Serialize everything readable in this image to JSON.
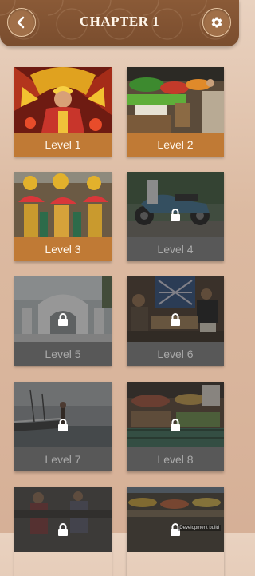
{
  "header": {
    "title": "CHAPTER 1",
    "back_icon": "chevron-left-icon",
    "settings_icon": "gear-icon"
  },
  "levels": [
    {
      "label": "Level 1",
      "locked": false,
      "scene": "festival-dancer"
    },
    {
      "label": "Level 2",
      "locked": false,
      "scene": "vegetable-market"
    },
    {
      "label": "Level 3",
      "locked": false,
      "scene": "festival-fan-dancers"
    },
    {
      "label": "Level 4",
      "locked": true,
      "scene": "motorbike"
    },
    {
      "label": "Level 5",
      "locked": true,
      "scene": "white-church"
    },
    {
      "label": "Level 6",
      "locked": true,
      "scene": "weaving-workshop"
    },
    {
      "label": "Level 7",
      "locked": true,
      "scene": "boat-on-water"
    },
    {
      "label": "Level 8",
      "locked": true,
      "scene": "market-crates"
    },
    {
      "label": "",
      "locked": true,
      "scene": "people-street"
    },
    {
      "label": "",
      "locked": true,
      "scene": "fruit-stall"
    }
  ],
  "watermark": "Development build",
  "colors": {
    "unlocked_label": "#c07a35",
    "locked_label": "#585858",
    "header": "#7a4d2e"
  }
}
